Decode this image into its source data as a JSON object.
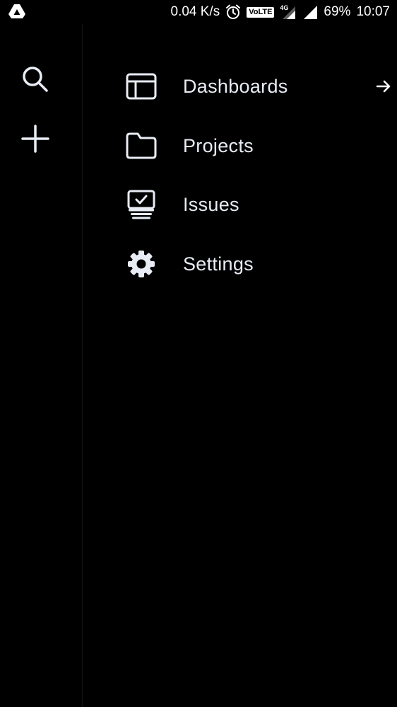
{
  "status_bar": {
    "net_speed": "0.04 K/s",
    "volte_label": "VoLTE",
    "network_label": "4G",
    "battery": "69%",
    "time": "10:07",
    "icons": [
      "drive-icon",
      "alarm-icon",
      "signal-icon",
      "signal-full-icon"
    ]
  },
  "rail": {
    "icons": [
      "search-icon",
      "plus-icon"
    ]
  },
  "menu": {
    "items": [
      {
        "label": "Dashboards",
        "icon": "dashboard-icon",
        "has_arrow": true
      },
      {
        "label": "Projects",
        "icon": "folder-icon",
        "has_arrow": false
      },
      {
        "label": "Issues",
        "icon": "issues-icon",
        "has_arrow": false
      },
      {
        "label": "Settings",
        "icon": "gear-icon",
        "has_arrow": false
      }
    ]
  },
  "colors": {
    "background": "#000000",
    "text": "#e8ecf4",
    "status_text": "#ffffff"
  }
}
